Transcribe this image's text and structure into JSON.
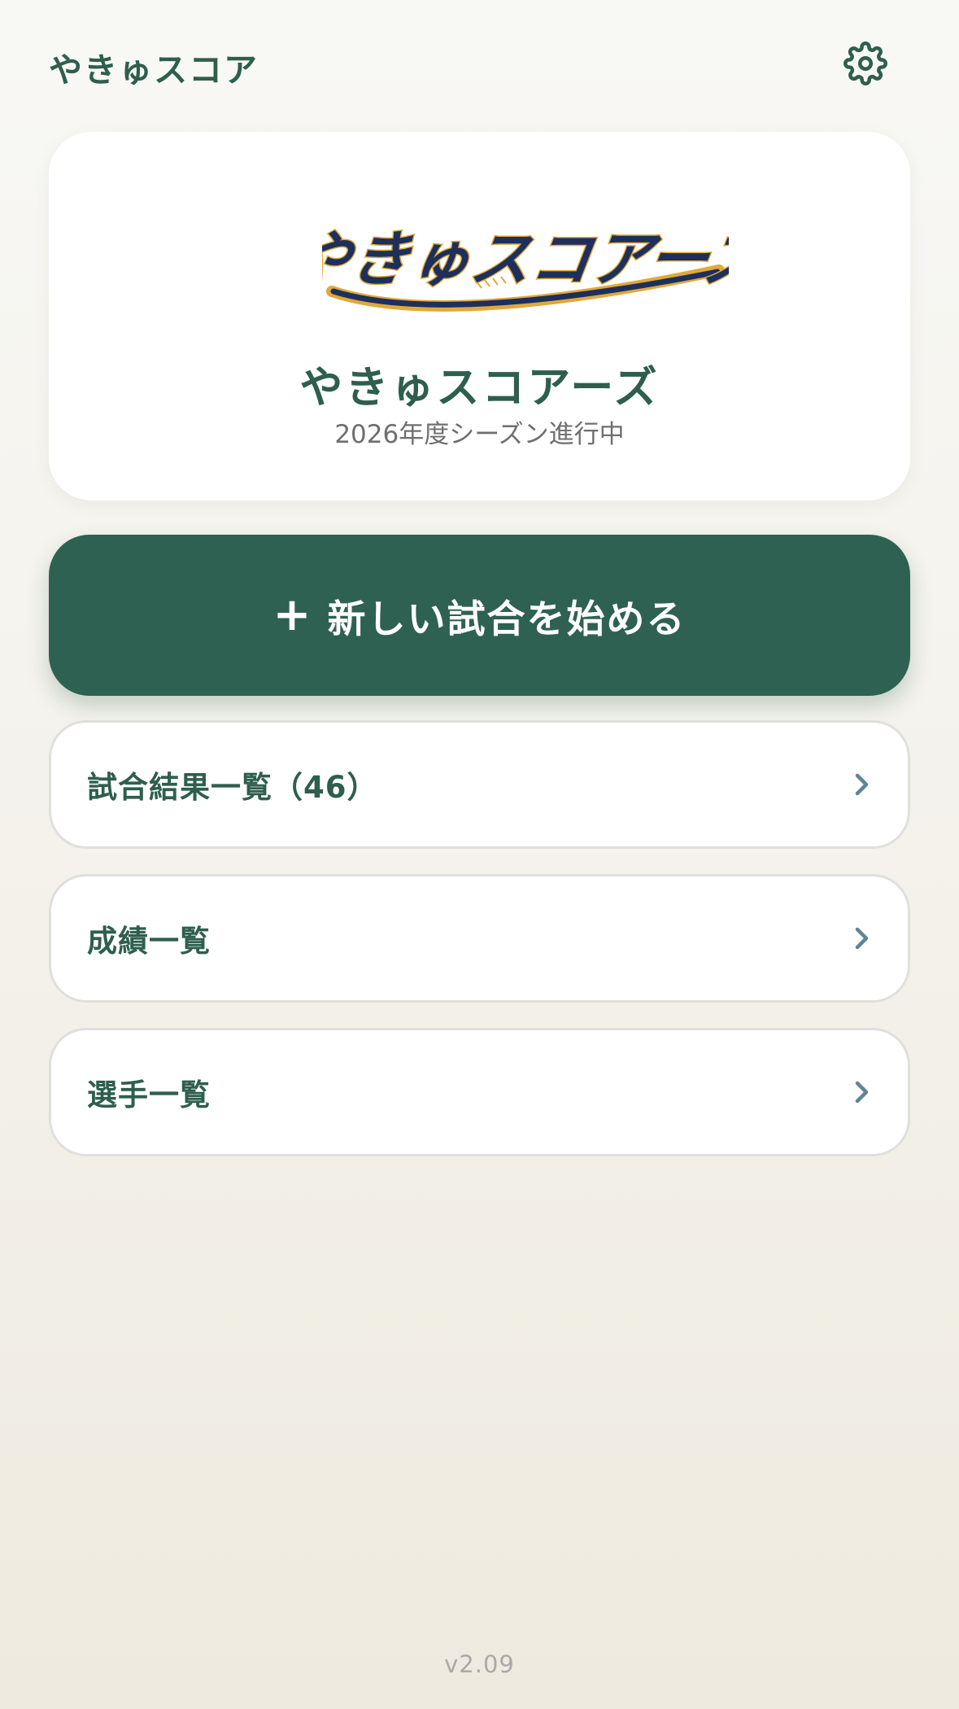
{
  "header": {
    "app_title": "やきゅスコア",
    "settings_icon": "gear-icon"
  },
  "team": {
    "logo_text": "やきゅスコアーズ",
    "name": "やきゅスコアーズ",
    "season_status": "2026年度シーズン進行中"
  },
  "actions": {
    "new_game_plus": "+",
    "new_game_label": "新しい試合を始める"
  },
  "menu": {
    "items": [
      {
        "label": "試合結果一覧（46）",
        "icon": "chevron-right-icon"
      },
      {
        "label": "成績一覧",
        "icon": "chevron-right-icon"
      },
      {
        "label": "選手一覧",
        "icon": "chevron-right-icon"
      }
    ]
  },
  "footer": {
    "version": "v2.09"
  },
  "colors": {
    "primary": "#2e6151",
    "text_primary": "#2e5e4e",
    "logo_navy": "#1d2f5c",
    "logo_gold": "#e0a93a",
    "chevron": "#5f8595"
  }
}
